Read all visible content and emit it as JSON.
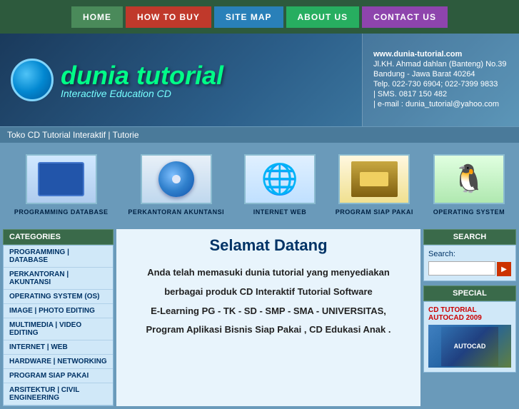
{
  "nav": {
    "items": [
      {
        "label": "HOME",
        "key": "home",
        "class": "nav-home"
      },
      {
        "label": "HOW TO BUY",
        "key": "howtobuy",
        "class": "nav-howtobuy"
      },
      {
        "label": "SITE MAP",
        "key": "sitemap",
        "class": "nav-sitemap"
      },
      {
        "label": "ABOUT US",
        "key": "aboutus",
        "class": "nav-aboutus"
      },
      {
        "label": "CONTACT US",
        "key": "contactus",
        "class": "nav-contactus"
      }
    ]
  },
  "header": {
    "brand_title": "dunia tutorial",
    "brand_subtitle": "Interactive Education CD",
    "url": "www.dunia-tutorial.com",
    "address1": "Jl.KH. Ahmad dahlan (Banteng) No.39",
    "address2": "Bandung - Jawa Barat 40264",
    "phone": "Telp. 022-730 6904; 022-7399 9833",
    "sms": "| SMS. 0817 150 482",
    "email": "| e-mail : dunia_tutorial@yahoo.com"
  },
  "ticker": {
    "text": "Toko CD Tutorial Interaktif | Tutorie"
  },
  "products": [
    {
      "label": "PROGRAMMING\nDATABASE",
      "key": "programming"
    },
    {
      "label": "PERKANTORAN\nAKUNTANSI",
      "key": "perkantoran"
    },
    {
      "label": "INTERNET\nWEB",
      "key": "internet"
    },
    {
      "label": "PROGRAM SIAP PAKAI",
      "key": "programsiap"
    },
    {
      "label": "OPERATING SYSTEM",
      "key": "os"
    }
  ],
  "sidebar": {
    "header": "CATEGORIES",
    "links": [
      "PROGRAMMING | DATABASE",
      "PERKANTORAN | AKUNTANSI",
      "OPERATING SYSTEM (OS)",
      "IMAGE | PHOTO EDITING",
      "MULTIMEDIA | VIDEO EDITING",
      "INTERNET | WEB",
      "HARDWARE | NETWORKING",
      "PROGRAM SIAP PAKAI",
      "ARSITEKTUR | CIVIL ENGINEERING"
    ]
  },
  "main": {
    "title": "Selamat Datang",
    "paragraphs": [
      "Anda telah memasuki dunia tutorial yang menyediakan",
      "berbagai  produk  CD  Interaktif  Tutorial Software",
      "E-Learning PG - TK - SD - SMP - SMA - UNIVERSITAS,",
      "Program Aplikasi Bisnis Siap Pakai , CD Edukasi Anak ."
    ]
  },
  "right": {
    "search_header": "SEARCH",
    "search_label": "Search:",
    "search_placeholder": "",
    "search_btn": "▶",
    "special_header": "SPECIAL",
    "special_link": "CD TUTORIAL AUTOCAD 2009"
  }
}
